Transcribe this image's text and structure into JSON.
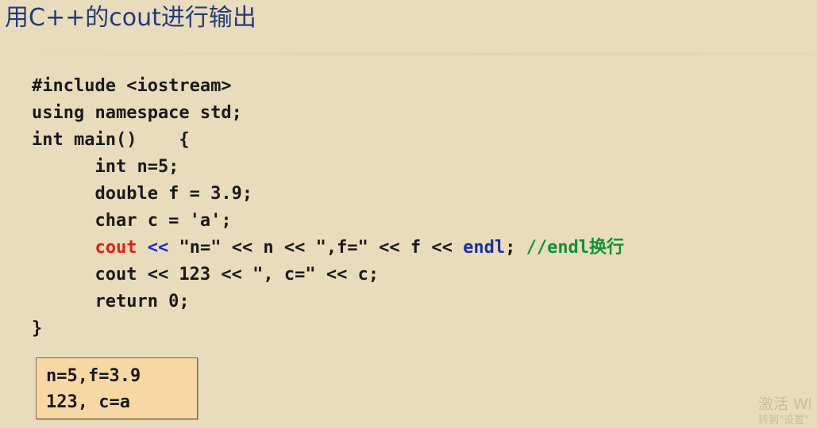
{
  "slide": {
    "title": "用C++的cout进行输出"
  },
  "code": {
    "lines": [
      [
        {
          "text": "#include <iostream>",
          "style": "plain"
        }
      ],
      [
        {
          "text": "using namespace std;",
          "style": "plain"
        }
      ],
      [
        {
          "text": "int main()    {",
          "style": "plain"
        }
      ],
      [
        {
          "text": "      int n=5;",
          "style": "plain"
        }
      ],
      [
        {
          "text": "      double f = 3.9;",
          "style": "plain"
        }
      ],
      [
        {
          "text": "      char c = 'a';",
          "style": "plain"
        }
      ],
      [
        {
          "text": "      ",
          "style": "plain"
        },
        {
          "text": "cout",
          "style": "keyword-red"
        },
        {
          "text": " ",
          "style": "plain"
        },
        {
          "text": "<<",
          "style": "op-blue"
        },
        {
          "text": " \"n=\" << n << \",f=\" << f << ",
          "style": "plain"
        },
        {
          "text": "endl",
          "style": "endl"
        },
        {
          "text": "; ",
          "style": "plain"
        },
        {
          "text": "//endl换行",
          "style": "comment"
        }
      ],
      [
        {
          "text": "      cout << 123 << \", c=\" << c;",
          "style": "plain"
        }
      ],
      [
        {
          "text": "      return 0;",
          "style": "plain"
        }
      ],
      [
        {
          "text": "}",
          "style": "plain"
        }
      ]
    ]
  },
  "output": {
    "lines": [
      "n=5,f=3.9",
      "123, c=a"
    ]
  },
  "watermark": {
    "line1": "激活 Wi",
    "line2": "转到\"设置\""
  },
  "colors": {
    "background": "#e9dcbc",
    "title": "#243a78",
    "code_text": "#1a1a1a",
    "highlight_red": "#e81c16",
    "highlight_blue": "#1a2ec8",
    "comment_green": "#139033",
    "output_box": "#f7d8a5"
  }
}
